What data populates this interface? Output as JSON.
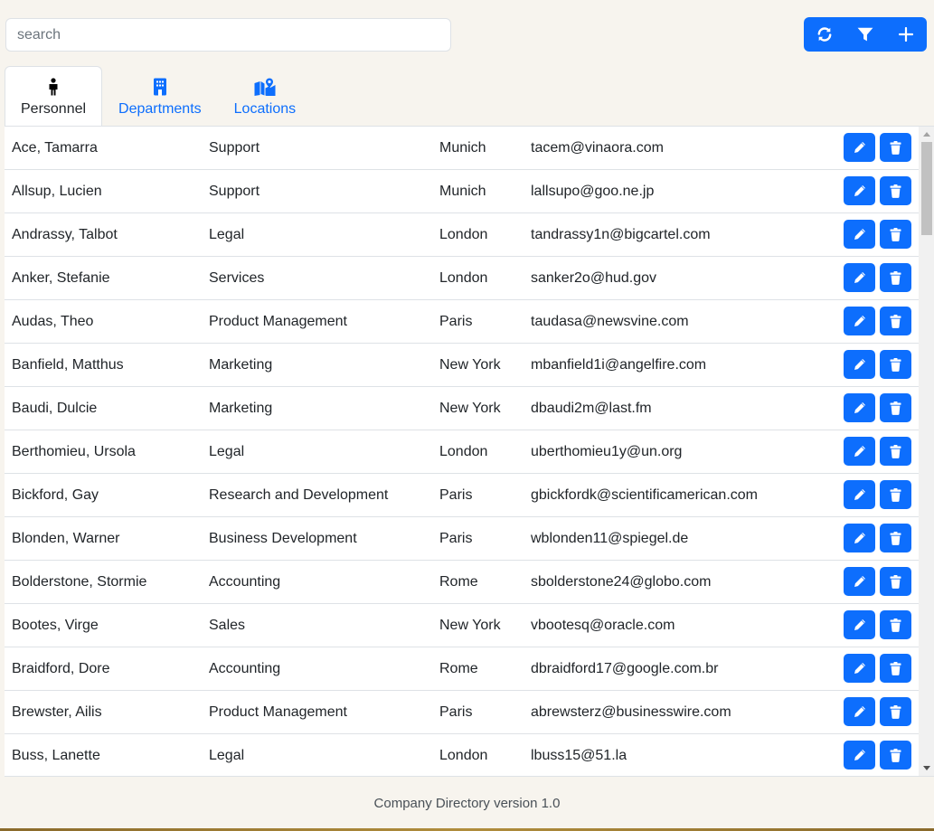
{
  "search": {
    "placeholder": "search",
    "value": ""
  },
  "toolbar": {
    "buttons": [
      {
        "icon": "refresh-icon"
      },
      {
        "icon": "filter-icon"
      },
      {
        "icon": "plus-icon"
      }
    ]
  },
  "tabs": [
    {
      "label": "Personnel",
      "icon": "person-icon",
      "active": true
    },
    {
      "label": "Departments",
      "icon": "building-icon",
      "active": false
    },
    {
      "label": "Locations",
      "icon": "map-location-icon",
      "active": false
    }
  ],
  "personnel": [
    {
      "name": "Ace, Tamarra",
      "department": "Support",
      "location": "Munich",
      "email": "tacem@vinaora.com"
    },
    {
      "name": "Allsup, Lucien",
      "department": "Support",
      "location": "Munich",
      "email": "lallsupo@goo.ne.jp"
    },
    {
      "name": "Andrassy, Talbot",
      "department": "Legal",
      "location": "London",
      "email": "tandrassy1n@bigcartel.com"
    },
    {
      "name": "Anker, Stefanie",
      "department": "Services",
      "location": "London",
      "email": "sanker2o@hud.gov"
    },
    {
      "name": "Audas, Theo",
      "department": "Product Management",
      "location": "Paris",
      "email": "taudasa@newsvine.com"
    },
    {
      "name": "Banfield, Matthus",
      "department": "Marketing",
      "location": "New York",
      "email": "mbanfield1i@angelfire.com"
    },
    {
      "name": "Baudi, Dulcie",
      "department": "Marketing",
      "location": "New York",
      "email": "dbaudi2m@last.fm"
    },
    {
      "name": "Berthomieu, Ursola",
      "department": "Legal",
      "location": "London",
      "email": "uberthomieu1y@un.org"
    },
    {
      "name": "Bickford, Gay",
      "department": "Research and Development",
      "location": "Paris",
      "email": "gbickfordk@scientificamerican.com"
    },
    {
      "name": "Blonden, Warner",
      "department": "Business Development",
      "location": "Paris",
      "email": "wblonden11@spiegel.de"
    },
    {
      "name": "Bolderstone, Stormie",
      "department": "Accounting",
      "location": "Rome",
      "email": "sbolderstone24@globo.com"
    },
    {
      "name": "Bootes, Virge",
      "department": "Sales",
      "location": "New York",
      "email": "vbootesq@oracle.com"
    },
    {
      "name": "Braidford, Dore",
      "department": "Accounting",
      "location": "Rome",
      "email": "dbraidford17@google.com.br"
    },
    {
      "name": "Brewster, Ailis",
      "department": "Product Management",
      "location": "Paris",
      "email": "abrewsterz@businesswire.com"
    },
    {
      "name": "Buss, Lanette",
      "department": "Legal",
      "location": "London",
      "email": "lbuss15@51.la"
    }
  ],
  "row_actions": {
    "edit_icon": "pencil-icon",
    "delete_icon": "trash-icon"
  },
  "footer": {
    "text": "Company Directory version 1.0"
  },
  "colors": {
    "primary": "#0d6efd",
    "background": "#f7f4ee"
  }
}
